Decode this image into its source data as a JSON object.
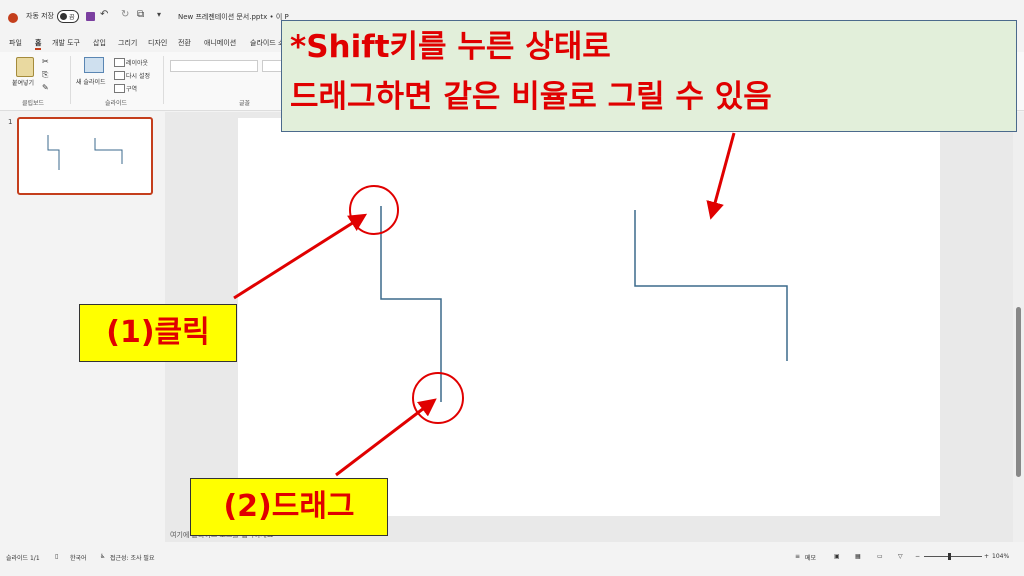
{
  "window": {
    "autosave_label": "자동 저장",
    "autosave_state": "끔",
    "title": "New 프레젠테이션 문서.pptx • 이 P"
  },
  "menu": [
    "파일",
    "홈",
    "개발 도구",
    "삽입",
    "그리기",
    "디자인",
    "전환",
    "애니메이션",
    "슬라이드 쇼"
  ],
  "ribbon": {
    "paste_label": "붙여넣기",
    "clipboard_group": "클립보드",
    "new_slide_label": "새 슬라이드",
    "layout_label": "레이아웃",
    "reset_label": "다시 설정",
    "section_label": "구역",
    "slides_group": "슬라이드",
    "font_group": "글꼴"
  },
  "thumbnail": {
    "number": "1"
  },
  "notes_placeholder": "여기에 슬라이드 노트를 입력하세요",
  "statusbar": {
    "slide_info": "슬라이드 1/1",
    "language": "한국어",
    "accessibility": "접근성: 조사 필요",
    "notes_button": "메모",
    "zoom_minus": "−",
    "zoom_plus": "+",
    "zoom_level": "104%"
  },
  "annotations": {
    "top_callout_line1": "*Shift키를 누른 상태로",
    "top_callout_line2": "드래그하면 같은 비율로 그릴 수 있음",
    "step1": "(1)클릭",
    "step2": "(2)드래그"
  },
  "colors": {
    "accent": "#c43e1c",
    "annotation_red": "#e00000",
    "label_yellow": "#ffff00",
    "callout_green": "#e2efda",
    "connector_line": "#3b6a8c"
  }
}
